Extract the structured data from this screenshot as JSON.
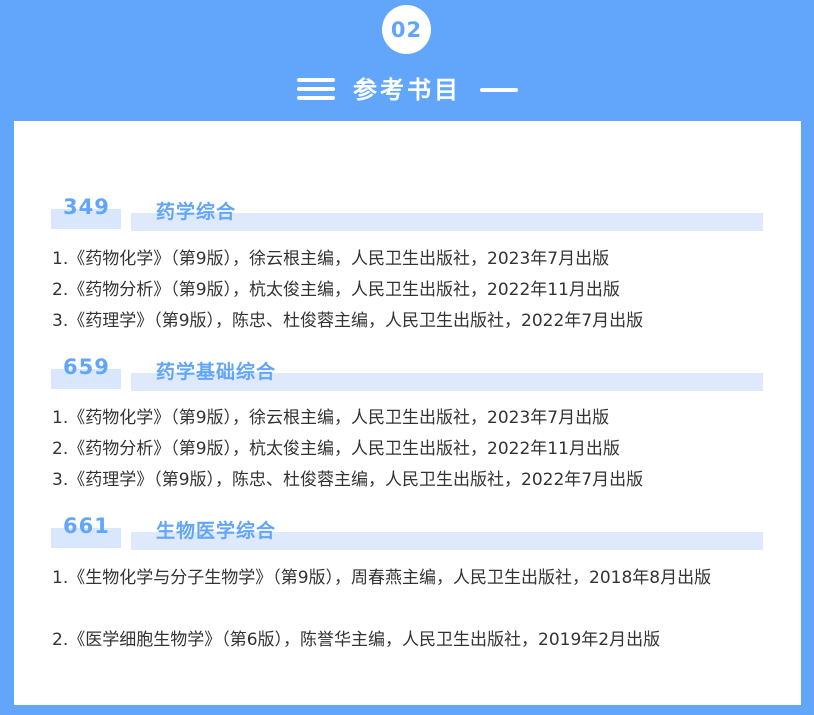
{
  "badge": "02",
  "header": {
    "title": "参考书目"
  },
  "sections": [
    {
      "code": "349",
      "subject": "药学综合",
      "books": [
        "1.《药物化学》（第9版），徐云根主编，人民卫生出版社，2023年7月出版",
        "2.《药物分析》（第9版），杭太俊主编，人民卫生出版社，2022年11月出版",
        "3.《药理学》（第9版），陈忠、杜俊蓉主编，人民卫生出版社，2022年7月出版"
      ]
    },
    {
      "code": "659",
      "subject": "药学基础综合",
      "books": [
        "1.《药物化学》（第9版），徐云根主编，人民卫生出版社，2023年7月出版",
        "2.《药物分析》（第9版），杭太俊主编，人民卫生出版社，2022年11月出版",
        "3.《药理学》（第9版），陈忠、杜俊蓉主编，人民卫生出版社，2022年7月出版"
      ]
    },
    {
      "code": "661",
      "subject": "生物医学综合",
      "books": [
        "1.《生物化学与分子生物学》（第9版），周春燕主编，人民卫生出版社，2018年8月出版",
        "2.《医学细胞生物学》（第6版），陈誉华主编，人民卫生出版社，2019年2月出版"
      ]
    }
  ],
  "colors": {
    "accent": "#62a6fb",
    "bar": "#deeafb",
    "text": "#333333",
    "panel": "#ffffff"
  },
  "icons": {
    "menu": "menu-lines-icon",
    "dash": "dash-line-icon"
  }
}
